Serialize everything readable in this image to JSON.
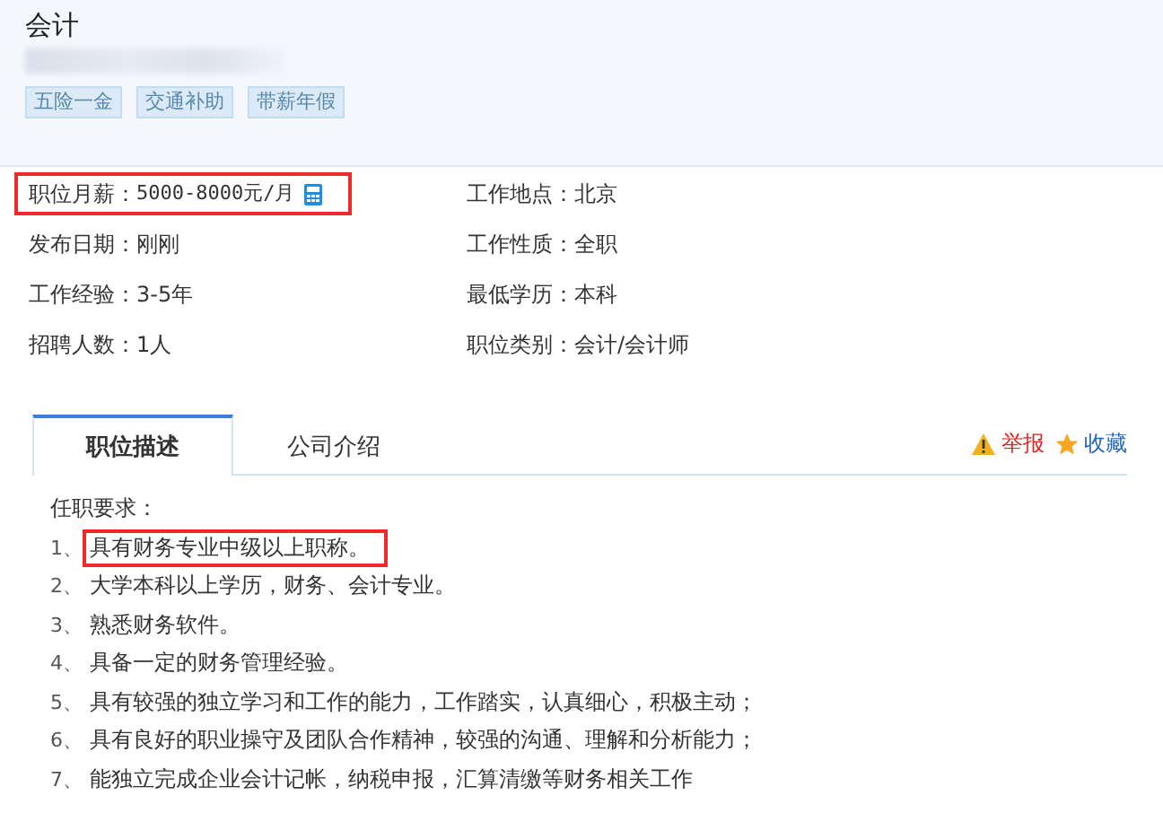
{
  "job": {
    "title": "会计",
    "company_blurred": true,
    "tags": [
      "五险一金",
      "交通补助",
      "带薪年假"
    ]
  },
  "details": [
    {
      "label": "职位月薪：",
      "value": "5000-8000元/月",
      "kind": "salary",
      "highlighted": true
    },
    {
      "label": "工作地点：",
      "value": "北京",
      "kind": "plain",
      "highlighted": false
    },
    {
      "label": "发布日期：",
      "value": "刚刚",
      "kind": "plain",
      "highlighted": false
    },
    {
      "label": "工作性质：",
      "value": "全职",
      "kind": "plain",
      "highlighted": false
    },
    {
      "label": "工作经验：",
      "value": "3-5年",
      "kind": "plain",
      "highlighted": false
    },
    {
      "label": "最低学历：",
      "value": "本科",
      "kind": "plain",
      "highlighted": false
    },
    {
      "label": "招聘人数：",
      "value": "1人",
      "kind": "plain",
      "highlighted": false
    },
    {
      "label": "职位类别：",
      "value": "会计/会计师",
      "kind": "plain",
      "highlighted": false
    }
  ],
  "tabs": [
    {
      "label": "职位描述",
      "selected": true
    },
    {
      "label": "公司介绍",
      "selected": false
    }
  ],
  "actions": [
    {
      "label": "举报",
      "kind": "report"
    },
    {
      "label": "收藏",
      "kind": "favorite"
    }
  ],
  "description": {
    "heading": "任职要求：",
    "requirements": [
      {
        "number": "1、",
        "text": "具有财务专业中级以上职称。",
        "highlighted": true
      },
      {
        "number": "2、",
        "text": "大学本科以上学历，财务、会计专业。",
        "highlighted": false
      },
      {
        "number": "3、",
        "text": "熟悉财务软件。",
        "highlighted": false
      },
      {
        "number": "4、",
        "text": "具备一定的财务管理经验。",
        "highlighted": false
      },
      {
        "number": "5、",
        "text": "具有较强的独立学习和工作的能力，工作踏实，认真细心，积极主动；",
        "highlighted": false
      },
      {
        "number": "6、",
        "text": "具有良好的职业操守及团队合作精神，较强的沟通、理解和分析能力；",
        "highlighted": false
      },
      {
        "number": "7、",
        "text": "能独立完成企业会计记帐，纳税申报，汇算清缴等财务相关工作",
        "highlighted": false
      }
    ]
  }
}
